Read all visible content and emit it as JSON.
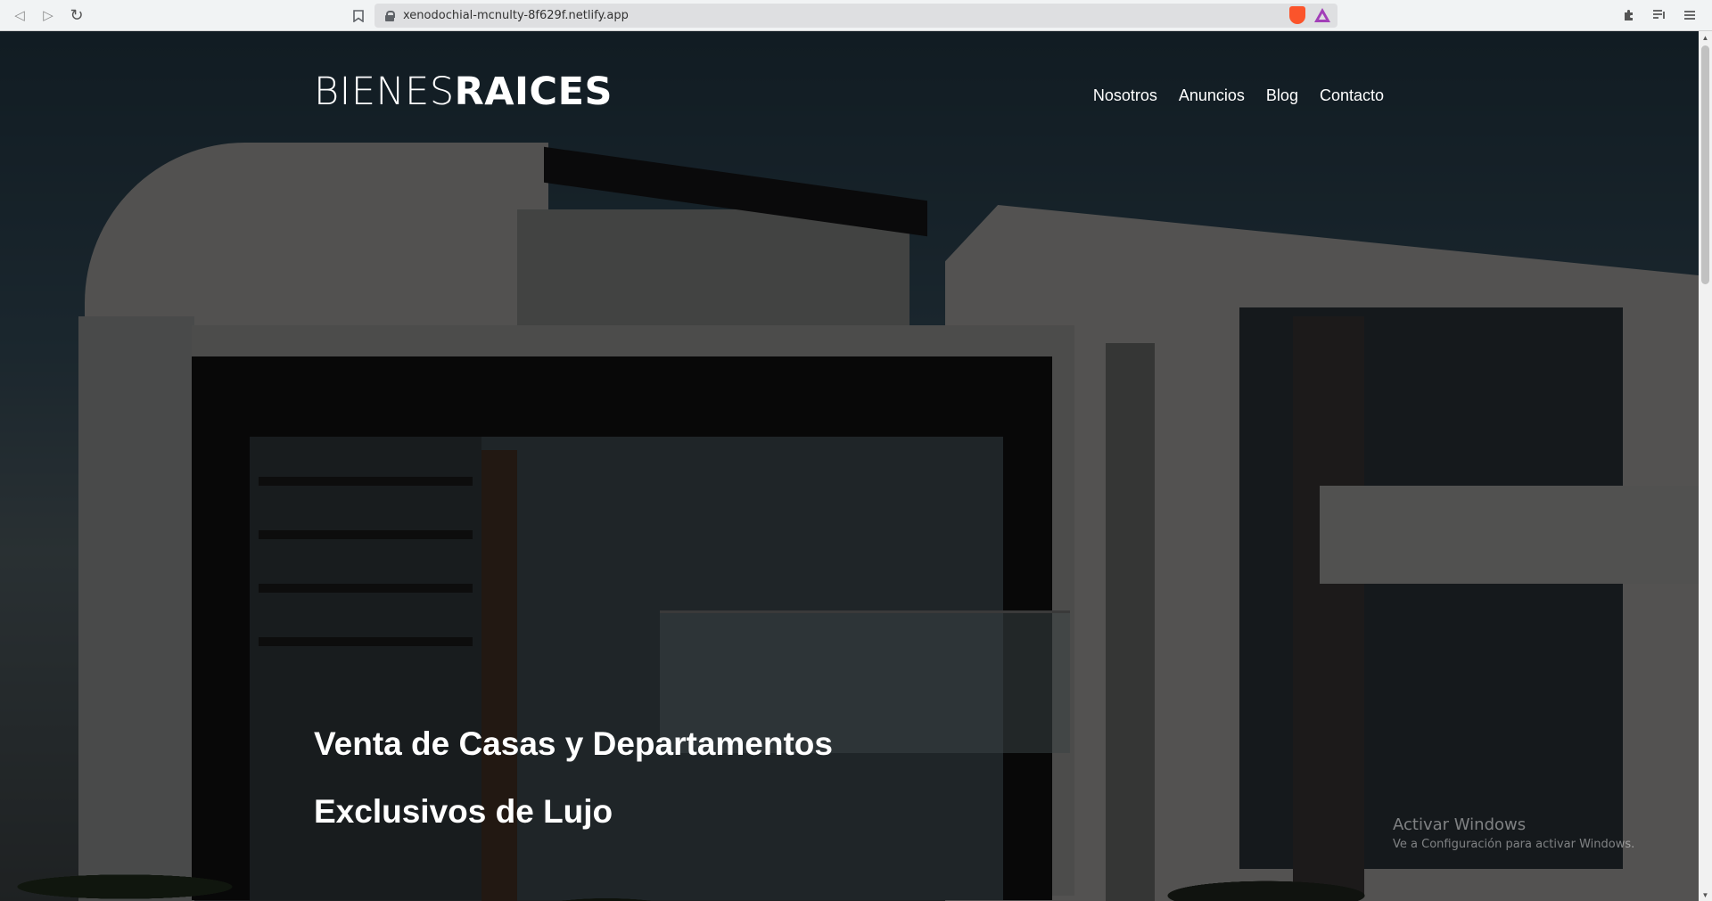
{
  "browser": {
    "back_icon": "back-arrow-icon",
    "forward_icon": "forward-arrow-icon",
    "reload_icon": "reload-icon",
    "url": "xenodochial-mcnulty-8f629f.netlify.app"
  },
  "header": {
    "logo_light": "BIENES",
    "logo_bold": "RAICES",
    "nav": [
      {
        "label": "Nosotros"
      },
      {
        "label": "Anuncios"
      },
      {
        "label": "Blog"
      },
      {
        "label": "Contacto"
      }
    ]
  },
  "hero": {
    "title": "Venta de Casas y Departamentos Exclusivos de Lujo"
  },
  "watermark": {
    "title": "Activar Windows",
    "subtitle": "Ve a Configuración para activar Windows."
  }
}
